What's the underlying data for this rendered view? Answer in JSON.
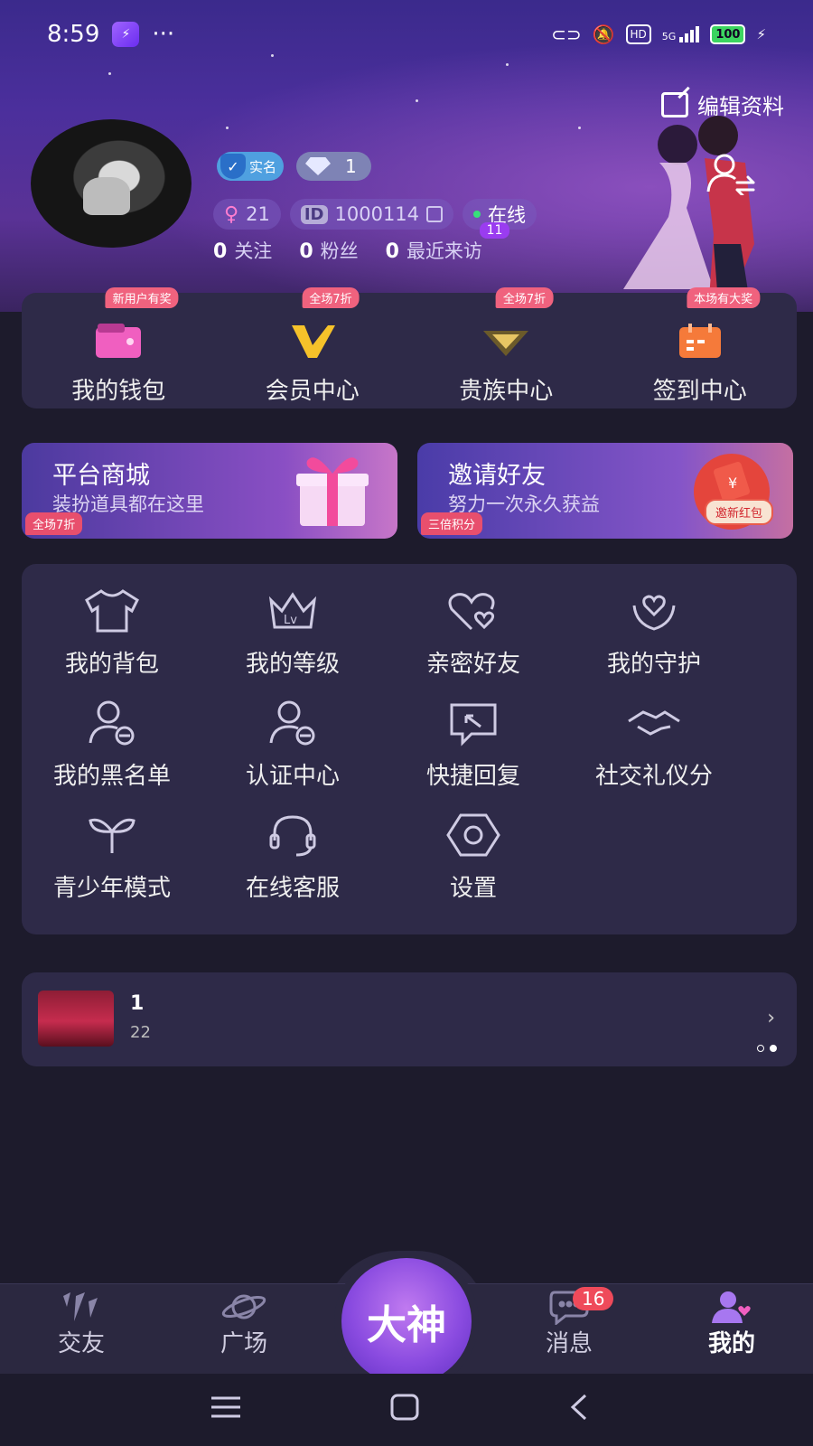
{
  "status_bar": {
    "time": "8:59",
    "dots": "···",
    "signal": "5G",
    "battery": "100",
    "hd": "HD"
  },
  "header": {
    "edit_label": "编辑资料",
    "verified_label": "实名",
    "diamond_count": "1"
  },
  "profile": {
    "age": "21",
    "id_label": "ID",
    "id_value": "1000114",
    "online_label": "在线",
    "stats": [
      {
        "count": "0",
        "label": "关注"
      },
      {
        "count": "0",
        "label": "粉丝"
      },
      {
        "count": "0",
        "label": "最近来访"
      }
    ],
    "visit_badge": "11"
  },
  "quick_menu": [
    {
      "label": "我的钱包",
      "tag": "新用户有奖",
      "icon": "wallet-icon"
    },
    {
      "label": "会员中心",
      "tag": "全场7折",
      "icon": "vip-icon"
    },
    {
      "label": "贵族中心",
      "tag": "全场7折",
      "icon": "noble-icon"
    },
    {
      "label": "签到中心",
      "tag": "本场有大奖",
      "icon": "calendar-icon"
    }
  ],
  "promos": {
    "mall": {
      "title": "平台商城",
      "subtitle": "装扮道具都在这里",
      "tag": "全场7折"
    },
    "invite": {
      "title": "邀请好友",
      "subtitle": "努力一次永久获益",
      "tag": "三倍积分",
      "button": "邀新红包"
    }
  },
  "services": [
    {
      "label": "我的背包",
      "icon": "shirt-icon"
    },
    {
      "label": "我的等级",
      "icon": "level-crown-icon"
    },
    {
      "label": "亲密好友",
      "icon": "hearts-icon"
    },
    {
      "label": "我的守护",
      "icon": "guard-heart-icon"
    },
    {
      "label": "我的黑名单",
      "icon": "user-block-icon"
    },
    {
      "label": "认证中心",
      "icon": "user-verify-icon"
    },
    {
      "label": "快捷回复",
      "icon": "reply-icon"
    },
    {
      "label": "社交礼仪分",
      "icon": "handshake-icon"
    },
    {
      "label": "青少年模式",
      "icon": "sprout-icon"
    },
    {
      "label": "在线客服",
      "icon": "headset-icon"
    },
    {
      "label": "设置",
      "icon": "settings-icon"
    }
  ],
  "banner": {
    "title": "1",
    "subtitle": "22"
  },
  "nav": {
    "items": [
      {
        "label": "交友",
        "icon": "app-logo-icon"
      },
      {
        "label": "广场",
        "icon": "planet-icon"
      },
      {
        "label": "消息",
        "icon": "chat-icon"
      },
      {
        "label": "我的",
        "icon": "profile-icon"
      }
    ],
    "center_label": "大神",
    "message_badge": "16"
  },
  "colors": {
    "accent": "#8a4be0",
    "panel": "#2e2a48",
    "tag": "#f0627e",
    "online": "#37e07a"
  }
}
